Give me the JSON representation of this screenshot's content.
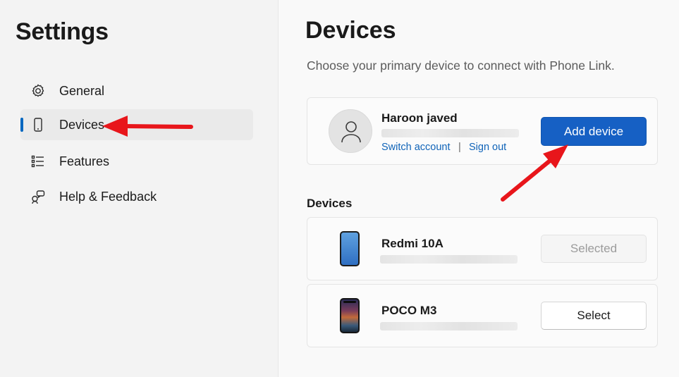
{
  "sidebar": {
    "title": "Settings",
    "items": [
      {
        "label": "General",
        "icon": "gear-icon",
        "active": false
      },
      {
        "label": "Devices",
        "icon": "phone-icon",
        "active": true
      },
      {
        "label": "Features",
        "icon": "list-icon",
        "active": false
      },
      {
        "label": "Help & Feedback",
        "icon": "help-feedback-icon",
        "active": false
      }
    ]
  },
  "main": {
    "title": "Devices",
    "subtitle": "Choose your primary device to connect with Phone Link.",
    "account": {
      "name": "Haroon javed",
      "switch_label": "Switch account",
      "separator": "|",
      "signout_label": "Sign out",
      "add_device_label": "Add device"
    },
    "devices_header": "Devices",
    "devices": [
      {
        "name": "Redmi 10A",
        "button_label": "Selected",
        "selected": true
      },
      {
        "name": "POCO M3",
        "button_label": "Select",
        "selected": false
      }
    ]
  },
  "colors": {
    "accent": "#1660c4",
    "annotation_arrow": "#e8161b"
  }
}
